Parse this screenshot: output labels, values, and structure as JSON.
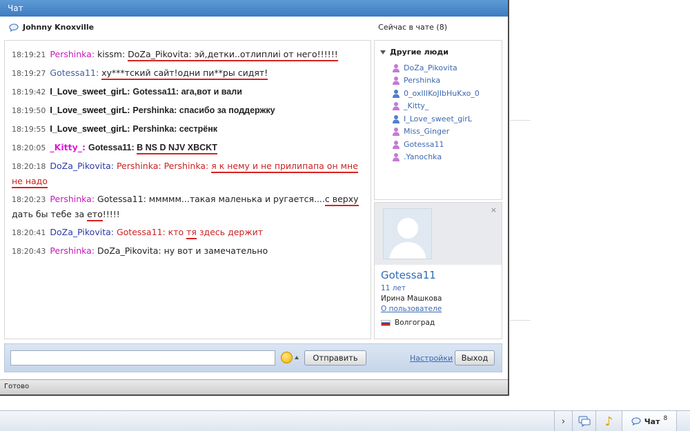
{
  "window": {
    "title": "Чат"
  },
  "header": {
    "user_name": "Johnny Knoxville",
    "in_chat_label": "Сейчас в чате (8)"
  },
  "messages": [
    {
      "time": "18:19:21",
      "nick": "Pershinka",
      "sep": ":",
      "pre": "kissm: ",
      "text": "DoZa_Pikovita: эй,детки..отлиплиi от него!!!!!!"
    },
    {
      "time": "18:19:27",
      "nick": "Gotessa11",
      "sep": ":",
      "text": "ху***тский сайт!одни пи**ры сидят!"
    },
    {
      "time": "18:19:42",
      "nick": "I_Love_sweet_girL",
      "sep": ":",
      "text": "Gotessa11: ага,вот и вали"
    },
    {
      "time": "18:19:50",
      "nick": "I_Love_sweet_girL",
      "sep": ":",
      "text": "Pershinka: спасибо за поддержку"
    },
    {
      "time": "18:19:55",
      "nick": "I_Love_sweet_girL",
      "sep": ":",
      "text": "Pershinka: сестрёнк"
    },
    {
      "time": "18:20:05",
      "nick": "_Kitty_",
      "sep": ":",
      "pre": "Gotessa11: ",
      "text": "B NS D NJV XBCKT"
    },
    {
      "time": "18:20:18",
      "nick": "DoZa_Pikovita",
      "sep": ":",
      "pre": "Pershinka: Pershinka: ",
      "text": "я к нему и не прилипапа он мне",
      "cont": "не надо"
    },
    {
      "time": "18:20:23",
      "nick": "Pershinka",
      "sep": ":",
      "pre": "Gotessa11: ммммм...такая маленька и ругается....",
      "text": "с верху",
      "cont_pre": "дать бы тебе за ",
      "cont": "ето",
      "cont_post": "!!!!!"
    },
    {
      "time": "18:20:41",
      "nick": "DoZa_Pikovita",
      "sep": ":",
      "pre": "Gotessa11: кто ",
      "text": "тя",
      "post": " здесь держит"
    },
    {
      "time": "18:20:43",
      "nick": "Pershinka",
      "sep": ":",
      "text": "DoZa_Pikovita: ну вот и замечательно"
    }
  ],
  "people": {
    "heading": "Другие люди",
    "items": [
      {
        "name": "DoZa_Pikovita",
        "gender": "female"
      },
      {
        "name": "Pershinka",
        "gender": "female"
      },
      {
        "name": "0_oxIIIKoJIbHuKxo_0",
        "gender": "male"
      },
      {
        "name": "_Kitty_",
        "gender": "female"
      },
      {
        "name": "I_Love_sweet_girL",
        "gender": "male"
      },
      {
        "name": "Miss_Ginger",
        "gender": "female"
      },
      {
        "name": "Gotessa11",
        "gender": "female"
      },
      {
        "name": ".Yanochka",
        "gender": "female"
      }
    ]
  },
  "profile": {
    "close": "×",
    "name": "Gotessa11",
    "age": "11 лет",
    "real_name": "Ирина Машкова",
    "link": "О пользователе",
    "city": "Волгоград"
  },
  "input": {
    "value": "",
    "send_label": "Отправить",
    "settings_label": "Настройки",
    "exit_label": "Выход"
  },
  "status": {
    "text": "Готово"
  },
  "taskbar": {
    "chevron": "›",
    "chat_label": "Чат",
    "chat_count": "8"
  },
  "colors": {
    "female_icon": "#c37ad6",
    "male_icon": "#4f7fd0",
    "underline": "#d82020"
  }
}
